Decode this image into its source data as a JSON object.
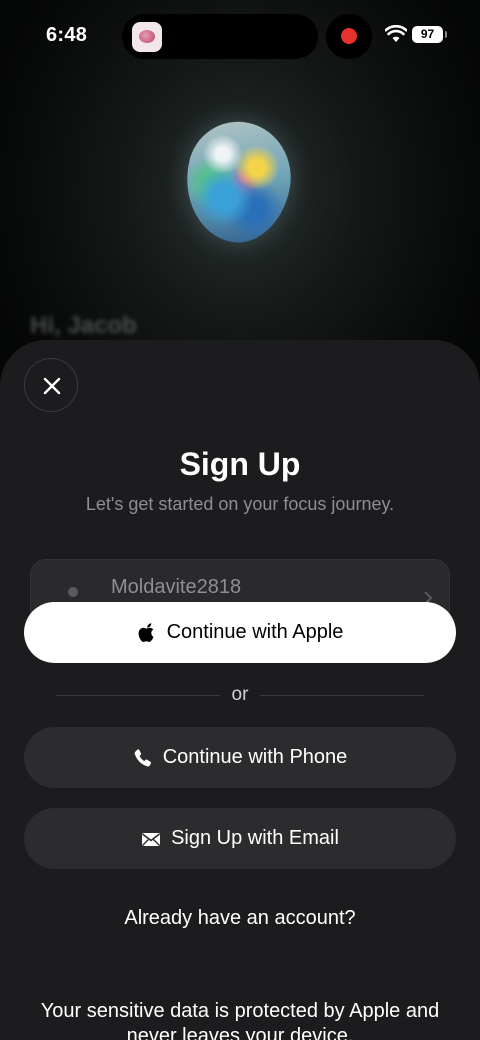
{
  "status_bar": {
    "time": "6:48",
    "battery": "97",
    "icons": [
      "app-icon",
      "record-icon",
      "wifi-icon",
      "battery-icon"
    ]
  },
  "background": {
    "greeting": "Hi, Jacob"
  },
  "sheet": {
    "close_icon": "close-icon",
    "title": "Sign Up",
    "subtitle": "Let's get started on your focus journey.",
    "username": "Moldavite2818",
    "buttons": {
      "apple": "Continue with Apple",
      "phone": "Continue with Phone",
      "email": "Sign Up with Email"
    },
    "divider": "or",
    "signin_link": "Already have an account?",
    "privacy_note": "Your sensitive data is protected by Apple and never leaves your device."
  },
  "colors": {
    "sheet_background": "#1c1c1e",
    "secondary_button": "#2c2c2e",
    "primary_button": "#ffffff",
    "record_dot": "#e5322d"
  }
}
